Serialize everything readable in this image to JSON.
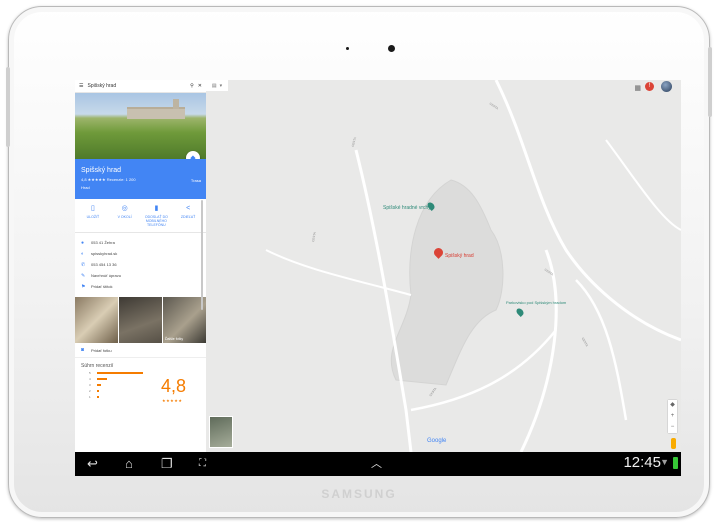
{
  "device": {
    "brand": "SAMSUNG"
  },
  "search": {
    "query": "Spišský hrad",
    "menu_icon": "menu-icon",
    "search_icon": "search-icon",
    "close_icon": "close-icon"
  },
  "place": {
    "name": "Spišský hrad",
    "rating_line": "4,8 ★★★★★ Recenzie: 1 200",
    "type": "Hrad",
    "directions_label": "Trasa"
  },
  "actions": [
    {
      "label": "ULOŽIŤ",
      "icon": "bookmark-icon"
    },
    {
      "label": "V OKOLÍ",
      "icon": "nearby-icon"
    },
    {
      "label": "ODOSLAŤ DO MOBILNÉHO TELEFÓNU",
      "icon": "phone-icon"
    },
    {
      "label": "ZDIEĽAŤ",
      "icon": "share-icon"
    }
  ],
  "info": [
    {
      "text": "053 41 Žehra",
      "icon": "location-icon"
    },
    {
      "text": "spisskyhrad.sk",
      "icon": "web-icon"
    },
    {
      "text": "053 454 13 36",
      "icon": "phone-icon"
    },
    {
      "text": "Navrhnúť úpravu",
      "icon": "edit-icon"
    },
    {
      "text": "Pridať štítok",
      "icon": "flag-icon"
    }
  ],
  "photos": {
    "last_caption": "Ďalšie fotky"
  },
  "add_photo_label": "Pridať fotku",
  "reviews": {
    "heading": "Súhrn recenzií",
    "rating": "4,8",
    "stars": "★★★★★"
  },
  "map": {
    "labels": {
      "viewpoint": "Spišské hradné vrchy",
      "castle": "Spišský hrad",
      "parking": "Parkovisko pod Spišským hradom"
    },
    "google": "Google"
  },
  "nav": {
    "time": "12:45"
  },
  "colors": {
    "accent": "#4285f4",
    "rating": "#f57c00",
    "marker": "#db4437",
    "map_bg": "#e9e9e8"
  }
}
